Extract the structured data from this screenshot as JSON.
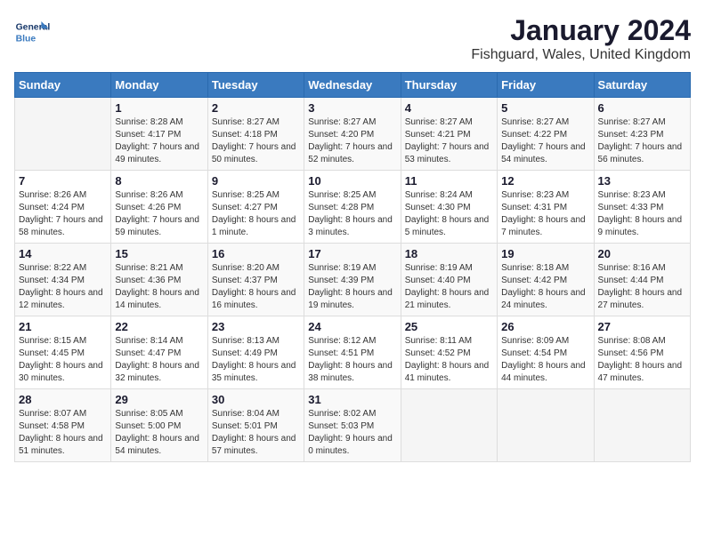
{
  "header": {
    "logo_general": "General",
    "logo_blue": "Blue",
    "title": "January 2024",
    "subtitle": "Fishguard, Wales, United Kingdom"
  },
  "days_of_week": [
    "Sunday",
    "Monday",
    "Tuesday",
    "Wednesday",
    "Thursday",
    "Friday",
    "Saturday"
  ],
  "weeks": [
    [
      {
        "day": "",
        "sunrise": "",
        "sunset": "",
        "daylight": ""
      },
      {
        "day": "1",
        "sunrise": "Sunrise: 8:28 AM",
        "sunset": "Sunset: 4:17 PM",
        "daylight": "Daylight: 7 hours and 49 minutes."
      },
      {
        "day": "2",
        "sunrise": "Sunrise: 8:27 AM",
        "sunset": "Sunset: 4:18 PM",
        "daylight": "Daylight: 7 hours and 50 minutes."
      },
      {
        "day": "3",
        "sunrise": "Sunrise: 8:27 AM",
        "sunset": "Sunset: 4:20 PM",
        "daylight": "Daylight: 7 hours and 52 minutes."
      },
      {
        "day": "4",
        "sunrise": "Sunrise: 8:27 AM",
        "sunset": "Sunset: 4:21 PM",
        "daylight": "Daylight: 7 hours and 53 minutes."
      },
      {
        "day": "5",
        "sunrise": "Sunrise: 8:27 AM",
        "sunset": "Sunset: 4:22 PM",
        "daylight": "Daylight: 7 hours and 54 minutes."
      },
      {
        "day": "6",
        "sunrise": "Sunrise: 8:27 AM",
        "sunset": "Sunset: 4:23 PM",
        "daylight": "Daylight: 7 hours and 56 minutes."
      }
    ],
    [
      {
        "day": "7",
        "sunrise": "Sunrise: 8:26 AM",
        "sunset": "Sunset: 4:24 PM",
        "daylight": "Daylight: 7 hours and 58 minutes."
      },
      {
        "day": "8",
        "sunrise": "Sunrise: 8:26 AM",
        "sunset": "Sunset: 4:26 PM",
        "daylight": "Daylight: 7 hours and 59 minutes."
      },
      {
        "day": "9",
        "sunrise": "Sunrise: 8:25 AM",
        "sunset": "Sunset: 4:27 PM",
        "daylight": "Daylight: 8 hours and 1 minute."
      },
      {
        "day": "10",
        "sunrise": "Sunrise: 8:25 AM",
        "sunset": "Sunset: 4:28 PM",
        "daylight": "Daylight: 8 hours and 3 minutes."
      },
      {
        "day": "11",
        "sunrise": "Sunrise: 8:24 AM",
        "sunset": "Sunset: 4:30 PM",
        "daylight": "Daylight: 8 hours and 5 minutes."
      },
      {
        "day": "12",
        "sunrise": "Sunrise: 8:23 AM",
        "sunset": "Sunset: 4:31 PM",
        "daylight": "Daylight: 8 hours and 7 minutes."
      },
      {
        "day": "13",
        "sunrise": "Sunrise: 8:23 AM",
        "sunset": "Sunset: 4:33 PM",
        "daylight": "Daylight: 8 hours and 9 minutes."
      }
    ],
    [
      {
        "day": "14",
        "sunrise": "Sunrise: 8:22 AM",
        "sunset": "Sunset: 4:34 PM",
        "daylight": "Daylight: 8 hours and 12 minutes."
      },
      {
        "day": "15",
        "sunrise": "Sunrise: 8:21 AM",
        "sunset": "Sunset: 4:36 PM",
        "daylight": "Daylight: 8 hours and 14 minutes."
      },
      {
        "day": "16",
        "sunrise": "Sunrise: 8:20 AM",
        "sunset": "Sunset: 4:37 PM",
        "daylight": "Daylight: 8 hours and 16 minutes."
      },
      {
        "day": "17",
        "sunrise": "Sunrise: 8:19 AM",
        "sunset": "Sunset: 4:39 PM",
        "daylight": "Daylight: 8 hours and 19 minutes."
      },
      {
        "day": "18",
        "sunrise": "Sunrise: 8:19 AM",
        "sunset": "Sunset: 4:40 PM",
        "daylight": "Daylight: 8 hours and 21 minutes."
      },
      {
        "day": "19",
        "sunrise": "Sunrise: 8:18 AM",
        "sunset": "Sunset: 4:42 PM",
        "daylight": "Daylight: 8 hours and 24 minutes."
      },
      {
        "day": "20",
        "sunrise": "Sunrise: 8:16 AM",
        "sunset": "Sunset: 4:44 PM",
        "daylight": "Daylight: 8 hours and 27 minutes."
      }
    ],
    [
      {
        "day": "21",
        "sunrise": "Sunrise: 8:15 AM",
        "sunset": "Sunset: 4:45 PM",
        "daylight": "Daylight: 8 hours and 30 minutes."
      },
      {
        "day": "22",
        "sunrise": "Sunrise: 8:14 AM",
        "sunset": "Sunset: 4:47 PM",
        "daylight": "Daylight: 8 hours and 32 minutes."
      },
      {
        "day": "23",
        "sunrise": "Sunrise: 8:13 AM",
        "sunset": "Sunset: 4:49 PM",
        "daylight": "Daylight: 8 hours and 35 minutes."
      },
      {
        "day": "24",
        "sunrise": "Sunrise: 8:12 AM",
        "sunset": "Sunset: 4:51 PM",
        "daylight": "Daylight: 8 hours and 38 minutes."
      },
      {
        "day": "25",
        "sunrise": "Sunrise: 8:11 AM",
        "sunset": "Sunset: 4:52 PM",
        "daylight": "Daylight: 8 hours and 41 minutes."
      },
      {
        "day": "26",
        "sunrise": "Sunrise: 8:09 AM",
        "sunset": "Sunset: 4:54 PM",
        "daylight": "Daylight: 8 hours and 44 minutes."
      },
      {
        "day": "27",
        "sunrise": "Sunrise: 8:08 AM",
        "sunset": "Sunset: 4:56 PM",
        "daylight": "Daylight: 8 hours and 47 minutes."
      }
    ],
    [
      {
        "day": "28",
        "sunrise": "Sunrise: 8:07 AM",
        "sunset": "Sunset: 4:58 PM",
        "daylight": "Daylight: 8 hours and 51 minutes."
      },
      {
        "day": "29",
        "sunrise": "Sunrise: 8:05 AM",
        "sunset": "Sunset: 5:00 PM",
        "daylight": "Daylight: 8 hours and 54 minutes."
      },
      {
        "day": "30",
        "sunrise": "Sunrise: 8:04 AM",
        "sunset": "Sunset: 5:01 PM",
        "daylight": "Daylight: 8 hours and 57 minutes."
      },
      {
        "day": "31",
        "sunrise": "Sunrise: 8:02 AM",
        "sunset": "Sunset: 5:03 PM",
        "daylight": "Daylight: 9 hours and 0 minutes."
      },
      {
        "day": "",
        "sunrise": "",
        "sunset": "",
        "daylight": ""
      },
      {
        "day": "",
        "sunrise": "",
        "sunset": "",
        "daylight": ""
      },
      {
        "day": "",
        "sunrise": "",
        "sunset": "",
        "daylight": ""
      }
    ]
  ]
}
